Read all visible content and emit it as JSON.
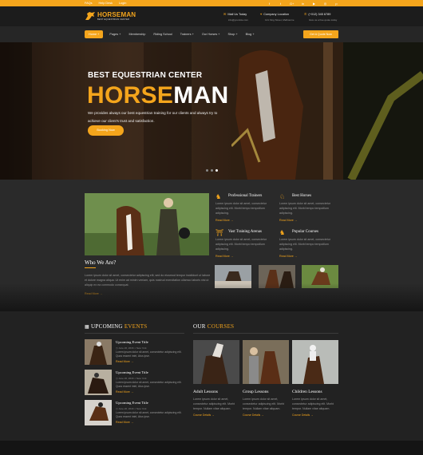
{
  "topbar": {
    "links": [
      "FAQs",
      "Help Desk",
      "Login"
    ],
    "social_icons": [
      "facebook-icon",
      "twitter-icon",
      "google-plus-icon",
      "linkedin-icon",
      "youtube-icon",
      "instagram-icon",
      "pinterest-icon"
    ],
    "social_glyphs": [
      "f",
      "t",
      "G+",
      "in",
      "▶",
      "◎",
      "p"
    ]
  },
  "header": {
    "logo_title": "HORSEMAN",
    "logo_sub": "BEST EQUESTRIAN CENTER",
    "mail_label": "Mail Us Today",
    "mail_value": "info@yoursite.com",
    "location_label": "Company Location",
    "location_value": "121 King Street, Melbourne",
    "phone_label": "(+012) 345 6789",
    "phone_value": "Give us a free quote today"
  },
  "nav": {
    "items": [
      "Home +",
      "Pages +",
      "Membership",
      "Riding School",
      "Trainers +",
      "Our Horses +",
      "Shop +",
      "Blog +"
    ],
    "quote_button": "Get A Quote Now"
  },
  "hero": {
    "subtitle": "BEST EQUESTRIAN CENTER",
    "title_a": "HORSE",
    "title_b": "MAN",
    "description": "We provides always our best equestrian training for our clients and always try to achieve our client's trust and satisfaction.",
    "button": "Booking Now",
    "slide_count": 3,
    "active_slide": 2
  },
  "about": {
    "title": "Who We Are?",
    "text": "Lorem ipsum dolor sit amet, consectetur adipiscing elit, sed do eiusmod tempor incididunt ut labore et dolore magna aliqua. Ut enim ad minim veniam, quis nostrud exercitation ullamco laboris nisi ut aliquip ex ea commodo consequat.",
    "more": "Read More →",
    "features": [
      {
        "title": "Professional Trainers",
        "desc": "Lorem ipsum dolor sit amet, consectetur adipiscing elit. Morbi tempo tempoillum adipiscing.",
        "more": "Read More →",
        "icon": "rider-icon"
      },
      {
        "title": "Best Horses",
        "desc": "Lorem ipsum dolor sit amet, consectetur adipiscing elit. Morbi tempo tempoillum adipiscing.",
        "more": "Read More →",
        "icon": "horse-icon"
      },
      {
        "title": "Vast Training Arenas",
        "desc": "Lorem ipsum dolor sit amet, consectetur adipiscing elit. Morbi tempo tempoillum adipiscing.",
        "more": "Read More →",
        "icon": "arena-icon"
      },
      {
        "title": "Popular Courses",
        "desc": "Lorem ipsum dolor sit amet, consectetur adipiscing elit. Morbi tempo tempoillum adipiscing.",
        "more": "Read More →",
        "icon": "jockey-icon"
      }
    ]
  },
  "events": {
    "title_a": "UPCOMING",
    "title_b": "EVENTS",
    "items": [
      {
        "title": "Upcoming Event Title",
        "date": "June 20, 2016",
        "place": "New York",
        "desc": "Lorem ipsum dolor sit amet, consectetur adipiscing elit. Quos essent intel, Atus ipse.",
        "more": "Read More →"
      },
      {
        "title": "Upcoming Event Title",
        "date": "June 20, 2016",
        "place": "New York",
        "desc": "Lorem ipsum dolor sit amet, consectetur adipiscing elit. Quos essent intel, Atus ipse.",
        "more": "Read More →"
      },
      {
        "title": "Upcoming Event Title",
        "date": "June 20, 2016",
        "place": "New York",
        "desc": "Lorem ipsum dolor sit amet, consectetur adipiscing elit. Quos essent intel, Atus ipse.",
        "more": "Read More →"
      }
    ]
  },
  "courses": {
    "title_a": "OUR",
    "title_b": "COURSES",
    "items": [
      {
        "title": "Adult Lessons",
        "desc": "Lorem ipsum dolor sit amet, consectetur adipiscing elit. Morbi tempor. Nullam vitae aliquam.",
        "more": "Course Details →"
      },
      {
        "title": "Group Lessons",
        "desc": "Lorem ipsum dolor sit amet, consectetur adipiscing elit. Morbi tempor. Nullam vitae aliquam.",
        "more": "Course Details →"
      },
      {
        "title": "Children Lessons",
        "desc": "Lorem ipsum dolor sit amet, consectetur adipiscing elit. Morbi tempor. Nullam vitae aliquam.",
        "more": "Course Details →"
      }
    ]
  },
  "colors": {
    "accent": "#f4a51c",
    "dark": "#222222",
    "panel": "#2a2a2a"
  }
}
